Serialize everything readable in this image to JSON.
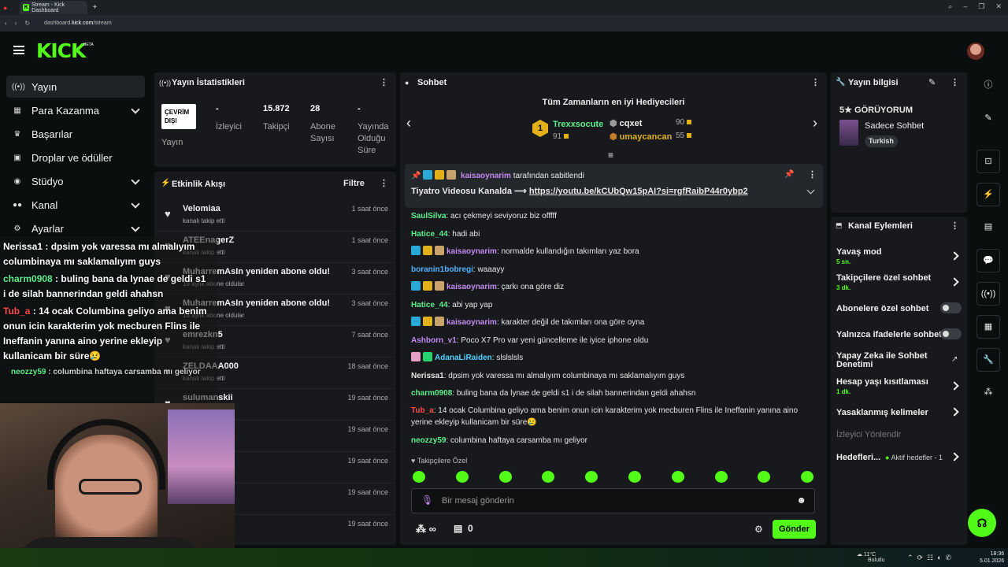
{
  "browser": {
    "tab_title": "Stream - Kick Dashboard",
    "url_prefix": "dashboard.",
    "url_host": "kick.com",
    "url_path": "/stream"
  },
  "header": {
    "logo": "KICK",
    "beta": "BETA"
  },
  "sidebar": {
    "items": [
      {
        "label": "Yayın",
        "icon": "broadcast-icon"
      },
      {
        "label": "Para Kazanma",
        "icon": "wallet-icon"
      },
      {
        "label": "Başarılar",
        "icon": "trophy-icon"
      },
      {
        "label": "Droplar ve ödüller",
        "icon": "gift-icon"
      },
      {
        "label": "Stüdyo",
        "icon": "studio-icon"
      },
      {
        "label": "Kanal",
        "icon": "users-icon"
      },
      {
        "label": "Ayarlar",
        "icon": "gear-icon"
      }
    ]
  },
  "stats": {
    "title": "Yayın İstatistikleri",
    "offline_badge": "ÇEVRİM DIŞI",
    "cols": [
      {
        "value": "",
        "label": "Yayın"
      },
      {
        "value": "-",
        "label": "İzleyici"
      },
      {
        "value": "15.872",
        "label": "Takipçi"
      },
      {
        "value": "28",
        "label": "Abone Sayısı"
      },
      {
        "value": "-",
        "label": "Yayında Olduğu Süre"
      }
    ]
  },
  "activity": {
    "title": "Etkinlik Akışı",
    "filter": "Filtre",
    "events": [
      {
        "name": "Velomiaa",
        "desc": "kanalı takip etti",
        "time": "1 saat önce"
      },
      {
        "name": "ATEEnagerZ",
        "desc": "kanalı takip etti",
        "time": "1 saat önce"
      },
      {
        "name": "MuharremAsIn yeniden abone oldu!",
        "desc": "19 aylık abone oldular",
        "time": "3 saat önce"
      },
      {
        "name": "MuharremAsIn yeniden abone oldu!",
        "desc": "18 aylık abone oldular",
        "time": "3 saat önce"
      },
      {
        "name": "emrezkn5",
        "desc": "kanalı takip etti",
        "time": "7 saat önce"
      },
      {
        "name": "ZELDAAA000",
        "desc": "kanalı takip etti",
        "time": "18 saat önce"
      },
      {
        "name": "sulumanskii",
        "desc": "",
        "time": "19 saat önce"
      },
      {
        "name": "",
        "desc": "",
        "time": "19 saat önce"
      },
      {
        "name": "",
        "desc": "",
        "time": "19 saat önce"
      },
      {
        "name": "",
        "desc": "",
        "time": "19 saat önce"
      },
      {
        "name": "",
        "desc": "",
        "time": "19 saat önce"
      }
    ]
  },
  "chat": {
    "title": "Sohbet",
    "gifters_title": "Tüm Zamanların en iyi Hediyecileri",
    "gifters": [
      {
        "rank": "1",
        "name": "Trexxsocute",
        "count": "91"
      },
      {
        "name": "cqxet",
        "count": "90"
      },
      {
        "name": "umaycancan",
        "count": "55"
      }
    ],
    "pinned_by": "kaisaoynarim",
    "pinned_suffix": "tarafından sabitlendi",
    "pinned_text": "Tiyatro Videosu Kanalda ⟶",
    "pinned_link": "https://youtu.be/kCUbQw15pAI?si=rgfRaibP44r0ybp2",
    "messages": [
      {
        "user": "SaulSilva",
        "color": "#5ef08c",
        "text": "acı çekmeyi seviyoruz biz offfff"
      },
      {
        "user": "Hatice_44",
        "color": "#5ef08c",
        "text": "hadi abi"
      },
      {
        "user": "kaisaoynarim",
        "color": "#c58bf2",
        "text": "normalde kullandığın takımları yaz bora"
      },
      {
        "user": "boranin1bobregi",
        "color": "#4fb3ff",
        "text": "waaayy"
      },
      {
        "user": "kaisaoynarim",
        "color": "#c58bf2",
        "text": "çarkı ona göre diz"
      },
      {
        "user": "Hatice_44",
        "color": "#5ef08c",
        "text": "abi yap yap"
      },
      {
        "user": "kaisaoynarim",
        "color": "#c58bf2",
        "text": "karakter değil de takımları ona göre oyna"
      },
      {
        "user": "Ashborn_v1",
        "color": "#c58bf2",
        "text": "Poco X7 Pro var yeni güncelleme ile iyice iphone oldu"
      },
      {
        "user": "AdanaLiRaiden",
        "color": "#4fd1ff",
        "text": "slslslsls"
      },
      {
        "user": "Nerissa1",
        "color": "#e6e6e6",
        "text": "dpsim yok varessa mı almalıyım columbinaya mı saklamalıyım guys"
      },
      {
        "user": "charm0908",
        "color": "#5ef08c",
        "text": "buling bana da lynae de geldi s1 i de silah bannerindan geldi ahahsn"
      },
      {
        "user": "Tub_a",
        "color": "#ff4a4a",
        "text": "14 ocak Columbina geliyo ama benim onun icin karakterim yok mecburen Flins ile Ineffanin yanına aino yerine ekleyip kullanicam bir süre😢"
      },
      {
        "user": "neozzy59",
        "color": "#5ef08c",
        "text": "columbina haftaya carsamba mı geliyor"
      }
    ],
    "followers_only": "Takipçilere Özel",
    "input_placeholder": "Bir mesaj gönderin",
    "points": "∞",
    "gift_count": "0",
    "send": "Gönder"
  },
  "stream_info": {
    "title": "Yayın bilgisi",
    "stream_title": "5★ GÖRÜYORUM",
    "category": "Sadece Sohbet",
    "tag": "Turkish"
  },
  "channel_actions": {
    "title": "Kanal Eylemleri",
    "slow_mode": "Yavaş mod",
    "slow_mode_value": "5 sn.",
    "followers_chat": "Takipçilere özel sohbet",
    "followers_chat_value": "3 dk.",
    "subs_chat": "Abonelere özel sohbet",
    "emote_chat": "Yalnızca ifadelerle sohbet",
    "ai_moderation": "Yapay Zeka ile Sohbet Denetimi",
    "age_restriction": "Hesap yaşı kısıtlaması",
    "age_restriction_value": "1 dk.",
    "banned_words": "Yasaklanmış kelimeler",
    "viewer_redirect": "İzleyici Yönlendir",
    "goals": "Hedefleri...",
    "goals_status": "Aktif hedefler - 1"
  },
  "overlay_chat": {
    "lines": [
      {
        "user": "Nerissa1",
        "text": " : dpsim yok varessa mı almalıyım columbinaya mı saklamalıyım guys"
      },
      {
        "user": "charm0908",
        "text": " : buling bana da lynae de geldi s1 i de silah bannerindan geldi ahahsn"
      },
      {
        "user": "Tub_a",
        "text": " : 14 ocak Columbina geliyo ama benim onun icin karakterim yok mecburen Flins ile Ineffanin yanına aino yerine ekleyip kullanicam bir süre😢"
      },
      {
        "user": "neozzy59",
        "text": " : columbina haftaya carsamba mı geliyor"
      }
    ]
  },
  "taskbar": {
    "weather_temp": "11°C",
    "weather_desc": "Bulutlu",
    "time": "18:36",
    "date": "5.01.2026"
  }
}
